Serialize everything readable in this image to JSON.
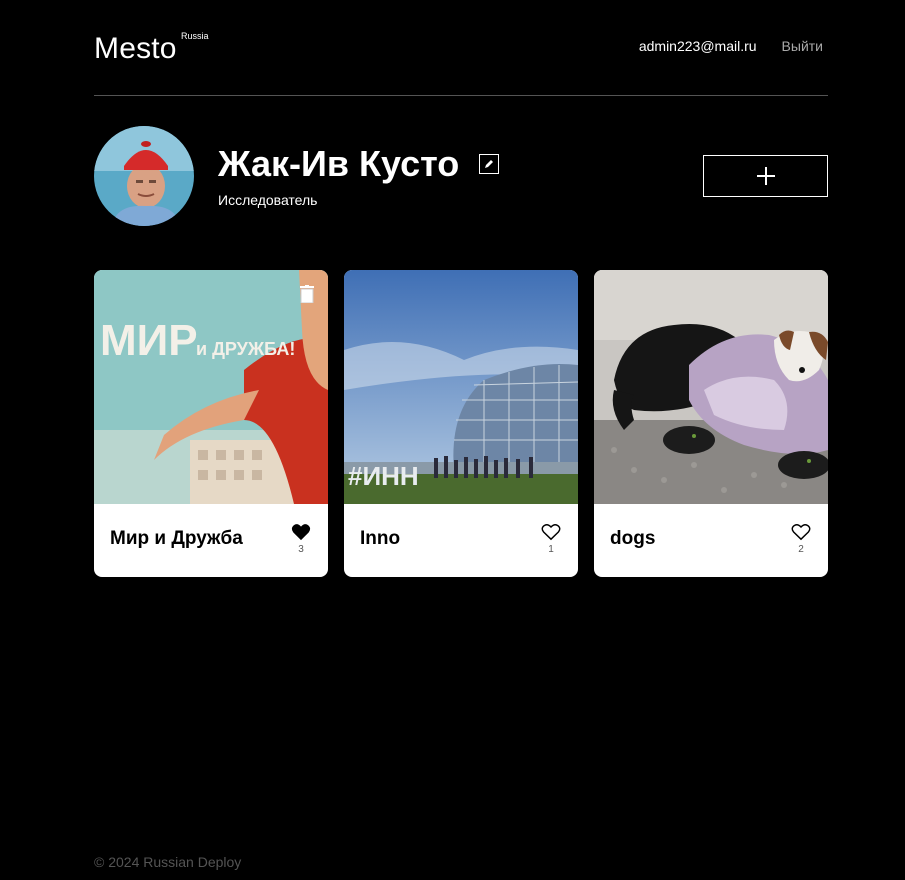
{
  "header": {
    "logo": "Mesto",
    "logo_sup": "Russia",
    "email": "admin223@mail.ru",
    "logout": "Выйти"
  },
  "profile": {
    "name": "Жак-Ив Кусто",
    "about": "Исследователь",
    "avatar_icon": "avatar-photo",
    "edit_icon": "pencil-icon",
    "add_icon": "plus-icon"
  },
  "cards": [
    {
      "title": "Мир и Дружба",
      "likes": "3",
      "liked": true
    },
    {
      "title": "Inno",
      "likes": "1",
      "liked": false
    },
    {
      "title": "dogs",
      "likes": "2",
      "liked": false
    }
  ],
  "footer": {
    "copyright": "© 2024 Russian Deploy"
  },
  "colors": {
    "background": "#000000",
    "divider": "#545454",
    "muted": "#a9a9a9",
    "card_bg": "#ffffff"
  }
}
